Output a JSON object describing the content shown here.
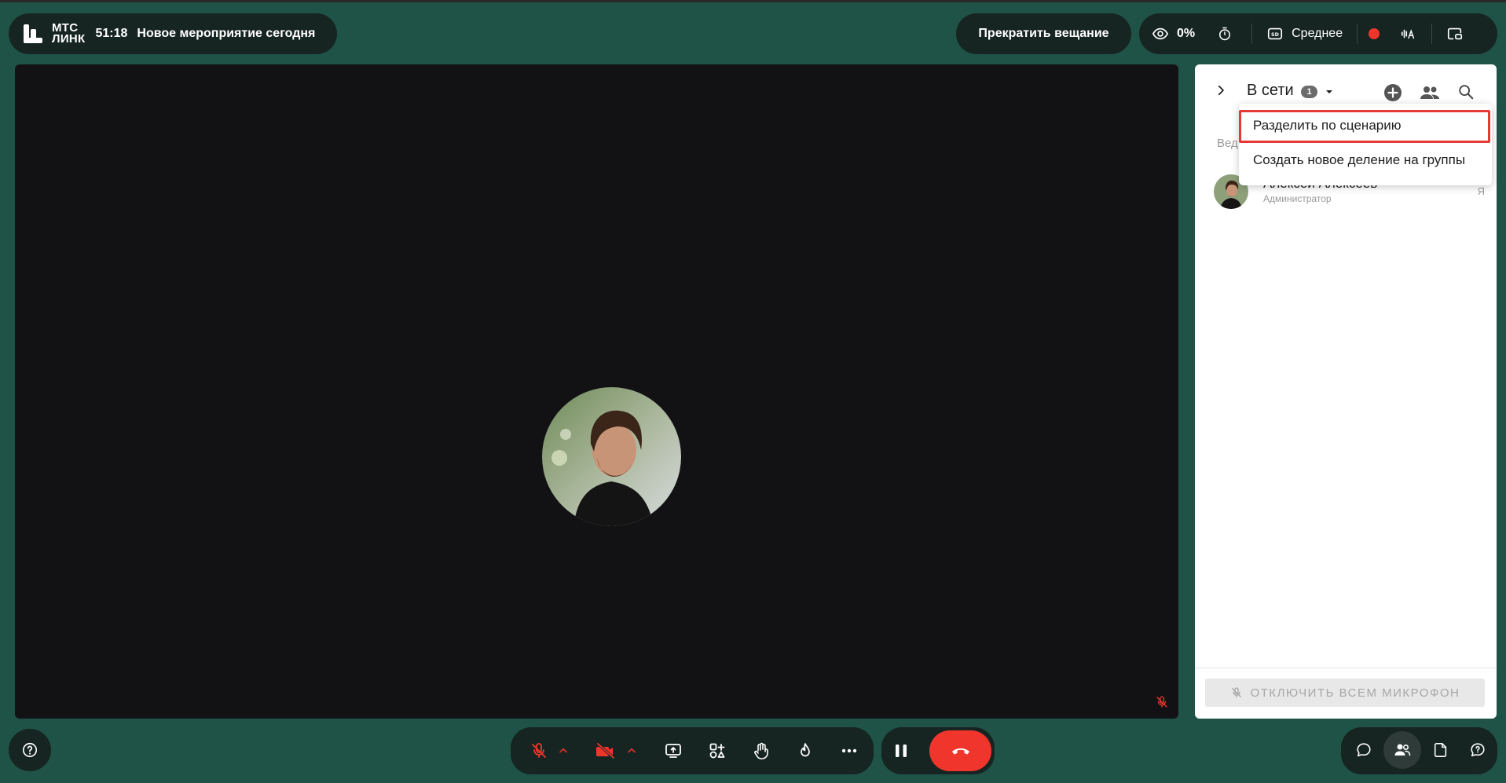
{
  "header": {
    "brand_line1": "МТС",
    "brand_line2": "ЛИНК",
    "timer": "51:18",
    "event_title": "Новое мероприятие сегодня",
    "stop_broadcast_label": "Прекратить вещание",
    "views_percent": "0%",
    "quality_label": "Среднее"
  },
  "participants_panel": {
    "tab_title": "В сети",
    "online_count": "1",
    "hosts_label": "Вед",
    "menu": {
      "items": [
        {
          "label": "Разделить по сценарию",
          "highlighted": true
        },
        {
          "label": "Создать новое деление на группы",
          "highlighted": false
        }
      ]
    },
    "participants": [
      {
        "name": "Алексей Алексеев",
        "role": "Администратор",
        "me_label": "Я"
      }
    ],
    "mute_all_label": "ОТКЛЮЧИТЬ ВСЕМ МИКРОФОН"
  },
  "colors": {
    "background": "#1f5347",
    "pill": "#162521",
    "recording": "#f0352c",
    "highlight": "#e53935"
  }
}
